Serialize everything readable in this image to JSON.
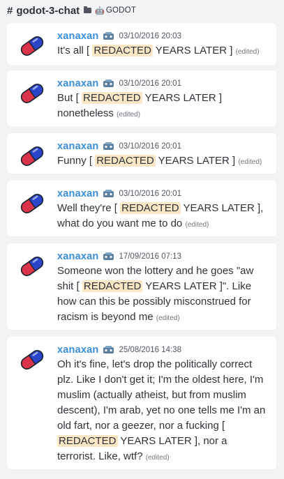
{
  "header": {
    "hash": "#",
    "channel": "godot-3-chat",
    "bot_glyph": "🤖",
    "server": "GODOT"
  },
  "messages": [
    {
      "author": "xanaxan",
      "timestamp": "03/10/2016 20:03",
      "parts": [
        "It's all [ ",
        "REDACTED",
        " YEARS LATER ]"
      ],
      "edited": "(edited)"
    },
    {
      "author": "xanaxan",
      "timestamp": "03/10/2016 20:01",
      "parts": [
        "But [ ",
        "REDACTED",
        " YEARS LATER ] nonetheless"
      ],
      "edited": "(edited)"
    },
    {
      "author": "xanaxan",
      "timestamp": "03/10/2016 20:01",
      "parts": [
        "Funny [ ",
        "REDACTED",
        " YEARS LATER ]"
      ],
      "edited": "(edited)"
    },
    {
      "author": "xanaxan",
      "timestamp": "03/10/2016 20:01",
      "parts": [
        "Well they're [ ",
        "REDACTED",
        " YEARS LATER ], what do you want me to do"
      ],
      "edited": "(edited)"
    },
    {
      "author": "xanaxan",
      "timestamp": "17/09/2016 07:13",
      "parts": [
        "Someone won the lottery and he goes \"aw shit [ ",
        "REDACTED",
        " YEARS LATER ]\". Like how can this be possibly misconstrued for racism is beyond me"
      ],
      "edited": "(edited)"
    },
    {
      "author": "xanaxan",
      "timestamp": "25/08/2016 14:38",
      "parts": [
        "Oh it's fine, let's drop the politically correct plz. Like I don't get it; I'm the oldest here, I'm muslim (actually atheist, but from muslim descent), I'm arab, yet no one tells me I'm an old fart, nor a geezer, nor a fucking [ ",
        "REDACTED",
        " YEARS LATER ], nor a terrorist. Like, wtf?"
      ],
      "edited": "(edited)"
    }
  ]
}
